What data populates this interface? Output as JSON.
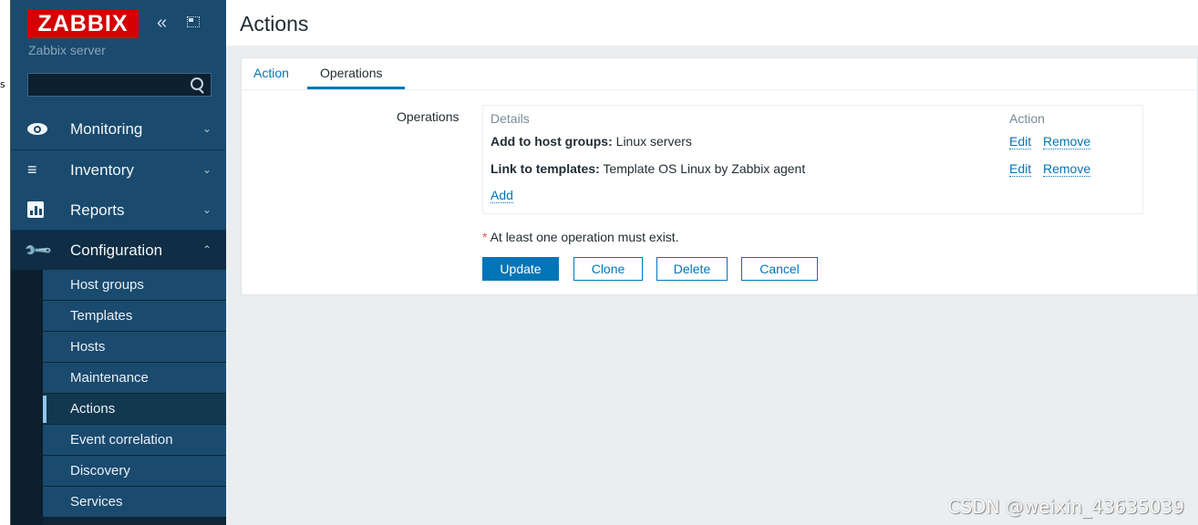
{
  "left_glyph": "s",
  "sidebar": {
    "logo": "ZABBIX",
    "server_name": "Zabbix server",
    "search_placeholder": "",
    "menu": [
      {
        "label": "Monitoring",
        "icon": "eye-icon"
      },
      {
        "label": "Inventory",
        "icon": "list-icon"
      },
      {
        "label": "Reports",
        "icon": "bar-chart-icon"
      },
      {
        "label": "Configuration",
        "icon": "wrench-icon"
      }
    ],
    "submenu": [
      "Host groups",
      "Templates",
      "Hosts",
      "Maintenance",
      "Actions",
      "Event correlation",
      "Discovery",
      "Services"
    ],
    "selected_submenu": "Actions"
  },
  "page": {
    "title": "Actions",
    "tabs": [
      "Action",
      "Operations"
    ],
    "active_tab": "Operations"
  },
  "form": {
    "label": "Operations",
    "table": {
      "headers": {
        "details": "Details",
        "action": "Action"
      },
      "rows": [
        {
          "key": "Add to host groups:",
          "value": " Linux servers",
          "edit": "Edit",
          "remove": "Remove"
        },
        {
          "key": "Link to templates:",
          "value": " Template OS Linux by Zabbix agent",
          "edit": "Edit",
          "remove": "Remove"
        }
      ],
      "add_link": "Add"
    },
    "required_note": "At least one operation must exist.",
    "buttons": {
      "update": "Update",
      "clone": "Clone",
      "delete": "Delete",
      "cancel": "Cancel"
    }
  },
  "watermark": "CSDN @weixin_43635039",
  "colors": {
    "accent": "#0275b8",
    "logo_red": "#d40000",
    "sidebar": "#1a4a6e"
  }
}
